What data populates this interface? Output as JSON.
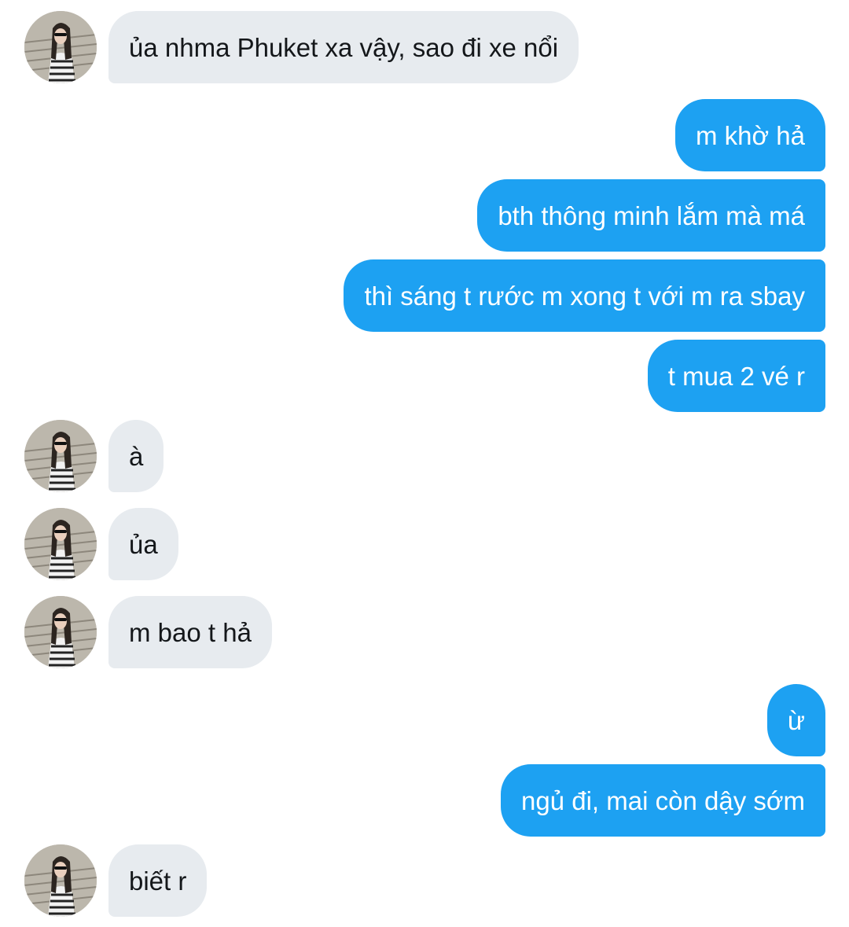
{
  "conversation": {
    "messages": [
      {
        "sender": "contact",
        "text": "ủa nhma Phuket xa vậy, sao đi xe nổi"
      },
      {
        "sender": "me",
        "text": "m khờ hả"
      },
      {
        "sender": "me",
        "text": "bth thông minh lắm mà má"
      },
      {
        "sender": "me",
        "text": "thì sáng t rước m xong t với m ra sbay"
      },
      {
        "sender": "me",
        "text": "t mua 2 vé r"
      },
      {
        "sender": "contact",
        "text": "à"
      },
      {
        "sender": "contact",
        "text": "ủa"
      },
      {
        "sender": "contact",
        "text": "m bao t hả"
      },
      {
        "sender": "me",
        "text": "ừ"
      },
      {
        "sender": "me",
        "text": "ngủ đi, mai còn dậy sớm"
      },
      {
        "sender": "contact",
        "text": "biết r"
      }
    ]
  },
  "theme": {
    "incoming_bubble": "#e7ebef",
    "outgoing_bubble": "#1da1f2",
    "incoming_text": "#14171a",
    "outgoing_text": "#ffffff"
  },
  "icons": {
    "avatar": "contact-avatar-photo"
  }
}
